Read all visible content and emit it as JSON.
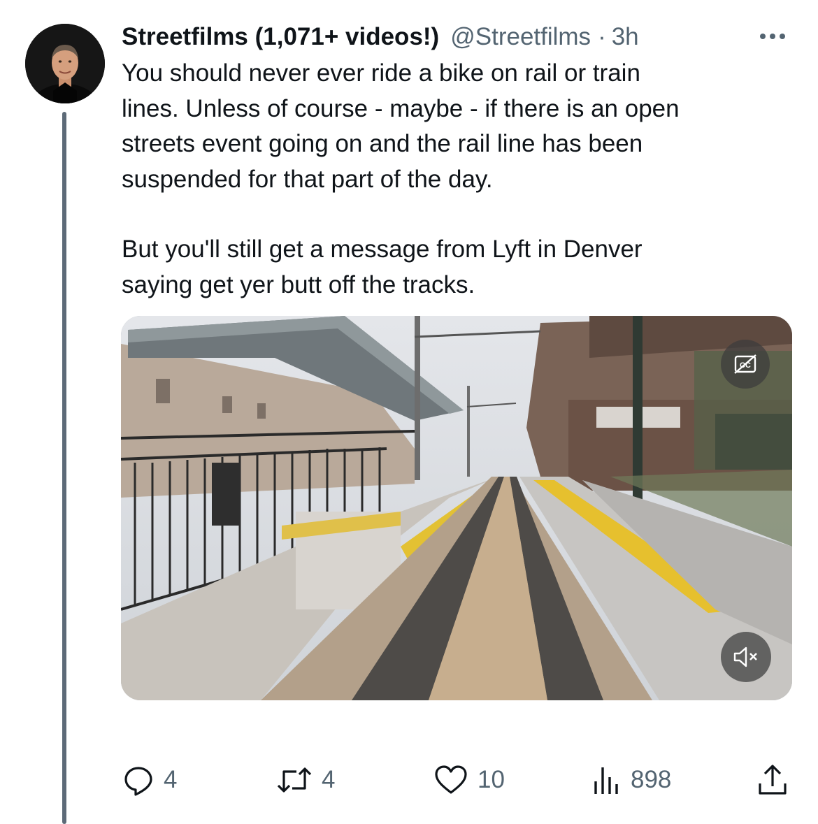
{
  "tweet": {
    "author": {
      "display_name": "Streetfilms (1,071+ videos!)",
      "handle": "@Streetfilms",
      "separator": "·",
      "time": "3h"
    },
    "paragraphs": [
      "You should never ever ride a bike on rail or train\nlines. Unless of course - maybe - if there is an open\nstreets event going on and the rail line has been\nsuspended for that part of the day.",
      "But you'll still get a message from Lyft in Denver\nsaying get yer butt off the tracks."
    ],
    "media": {
      "type": "video",
      "cc_icon": "closed-captions-off-icon",
      "mute_icon": "volume-muted-icon"
    },
    "actions": {
      "replies": "4",
      "retweets": "4",
      "likes": "10",
      "views": "898"
    },
    "icons": {
      "more": "more-horizontal-icon",
      "reply": "reply-icon",
      "retweet": "retweet-icon",
      "like": "heart-icon",
      "views": "views-chart-icon",
      "share": "share-icon"
    }
  },
  "colors": {
    "text_primary": "#0f1419",
    "text_secondary": "#536471",
    "thread_line": "#5d6a78"
  }
}
